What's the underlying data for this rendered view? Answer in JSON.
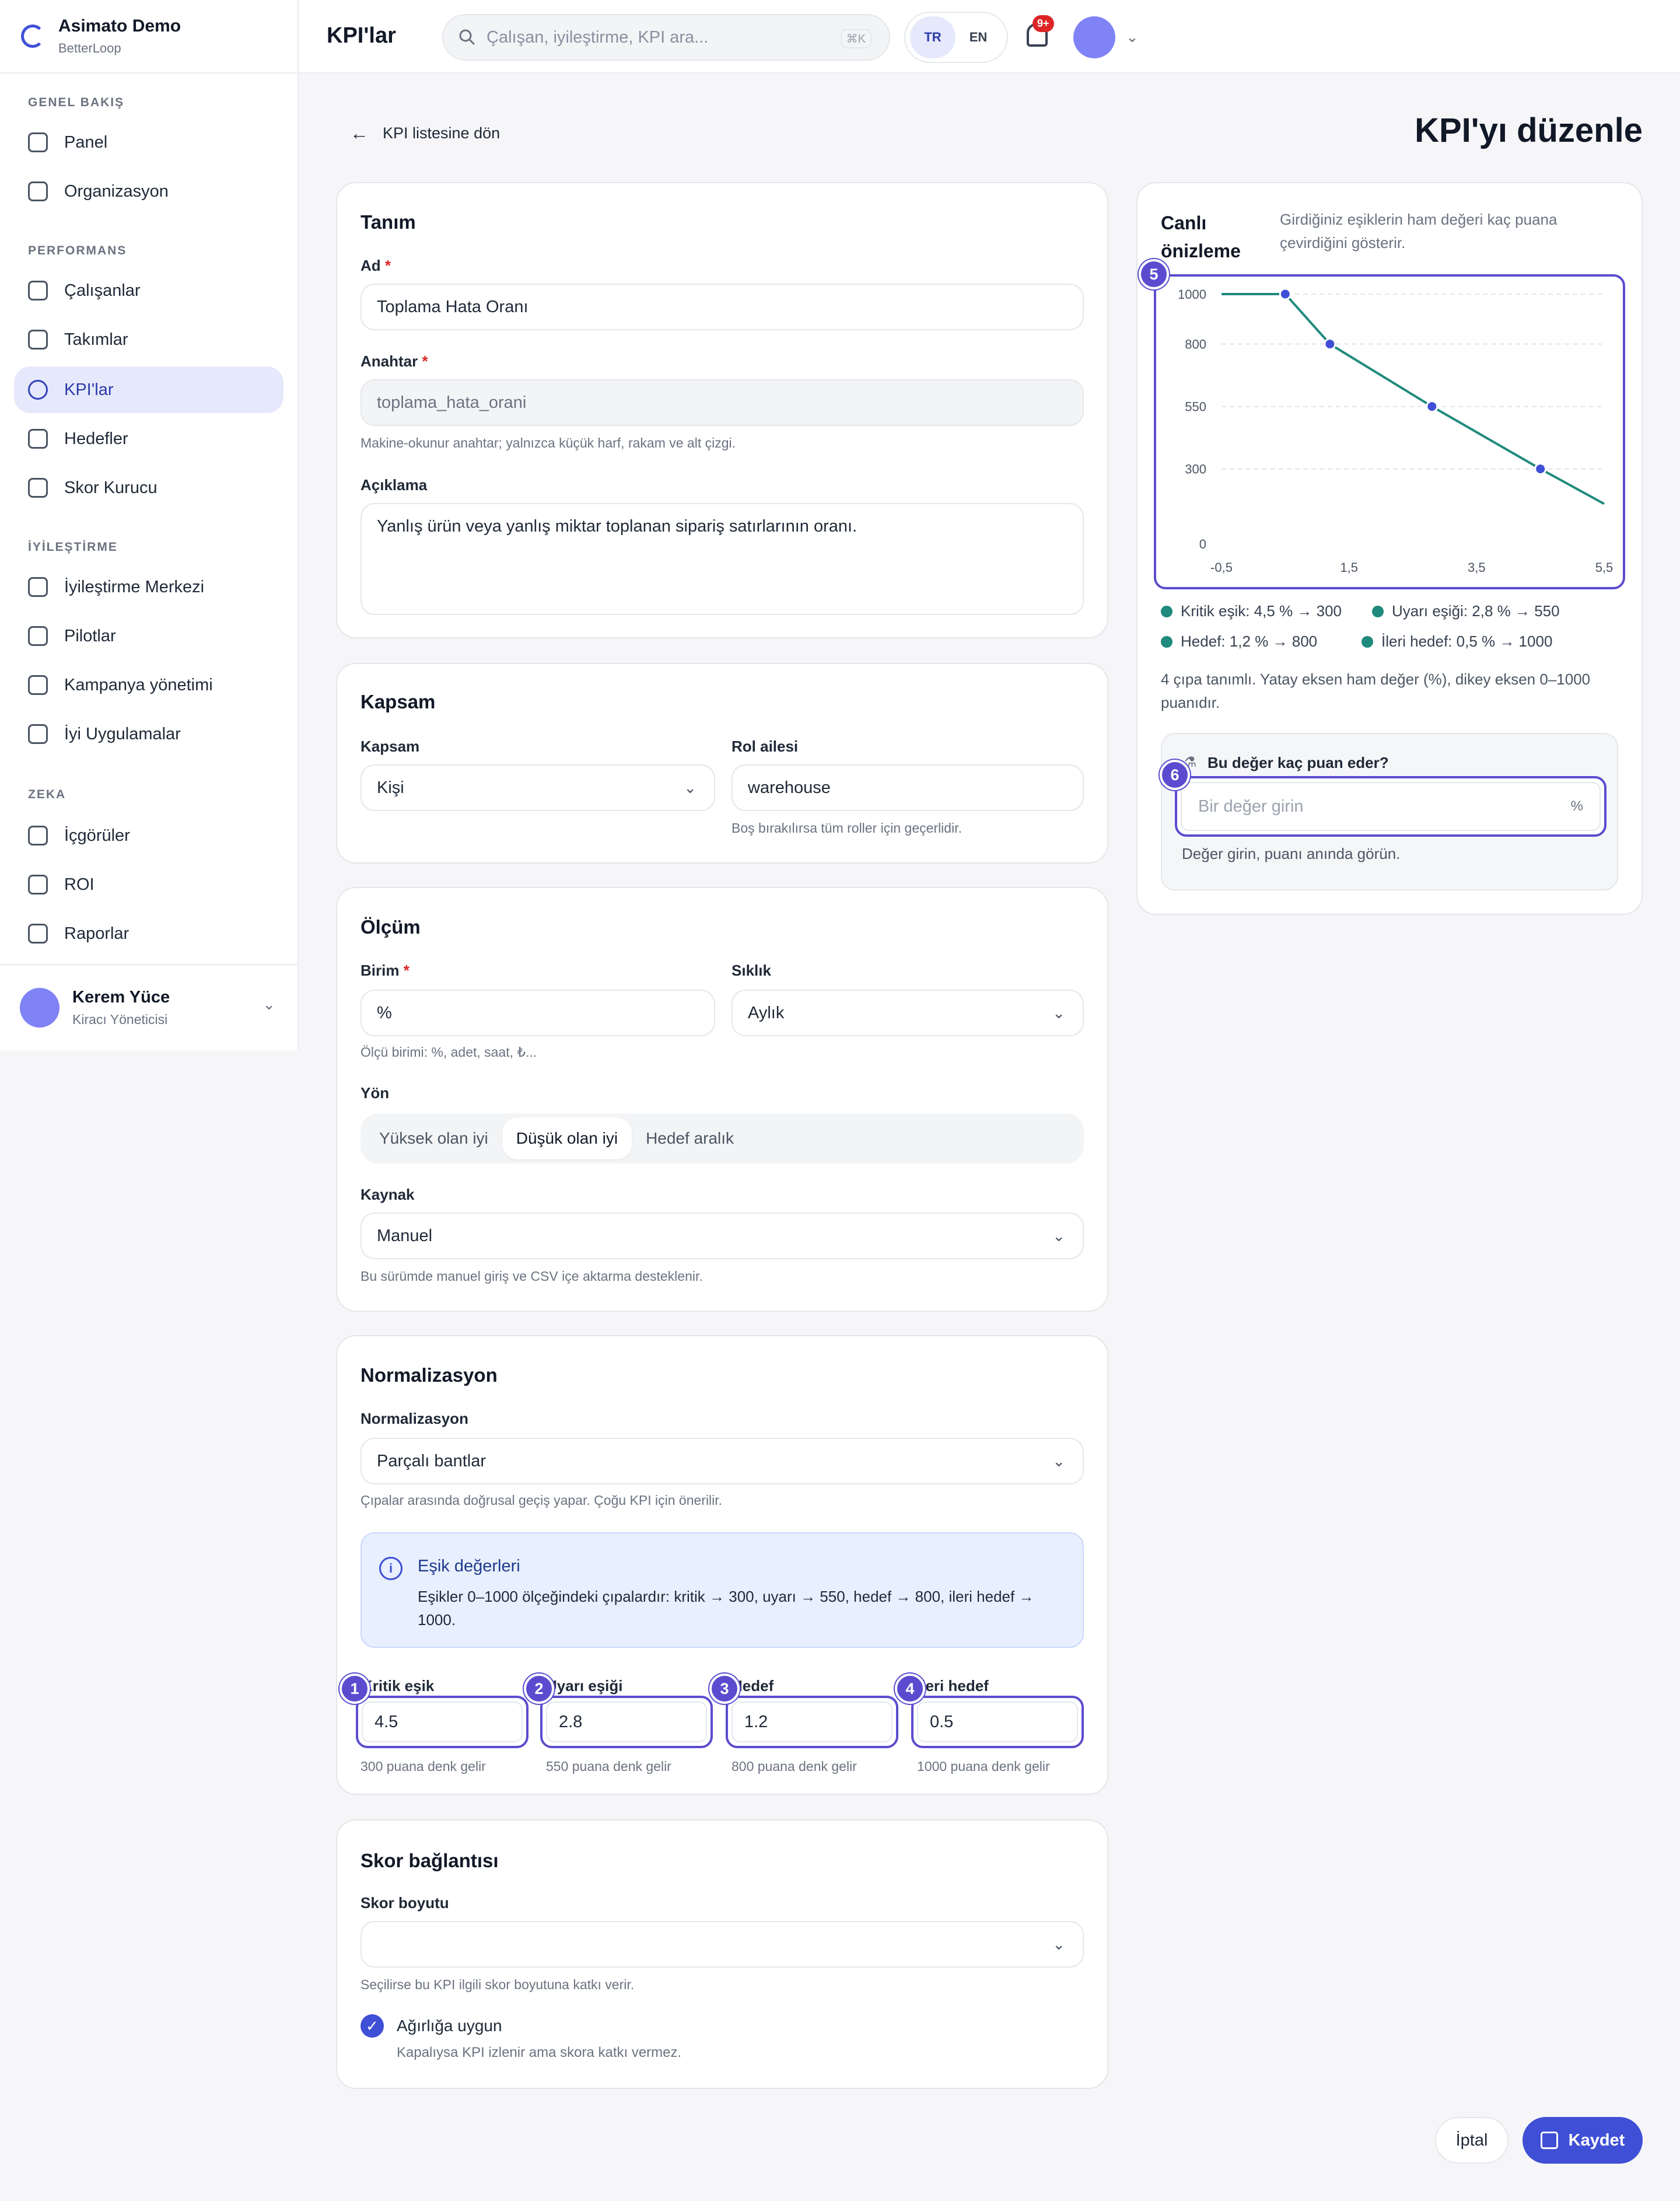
{
  "brand": {
    "name": "Asimato Demo",
    "sub": "BetterLoop"
  },
  "sidebar": {
    "sections": [
      {
        "title": "GENEL BAKIŞ",
        "items": [
          {
            "label": "Panel",
            "icon": "grid-icon"
          },
          {
            "label": "Organizasyon",
            "icon": "building-icon"
          }
        ]
      },
      {
        "title": "PERFORMANS",
        "items": [
          {
            "label": "Çalışanlar",
            "icon": "users-icon"
          },
          {
            "label": "Takımlar",
            "icon": "team-icon"
          },
          {
            "label": "KPI'lar",
            "icon": "gauge-icon",
            "active": true
          },
          {
            "label": "Hedefler",
            "icon": "target-icon"
          },
          {
            "label": "Skor Kurucu",
            "icon": "sliders-icon"
          }
        ]
      },
      {
        "title": "İYİLEŞTİRME",
        "items": [
          {
            "label": "İyileştirme Merkezi",
            "icon": "lightbulb-icon"
          },
          {
            "label": "Pilotlar",
            "icon": "flask-icon"
          },
          {
            "label": "Kampanya yönetimi",
            "icon": "clipboard-icon"
          },
          {
            "label": "İyi Uygulamalar",
            "icon": "book-icon"
          }
        ]
      },
      {
        "title": "ZEKA",
        "items": [
          {
            "label": "İçgörüler",
            "icon": "sparkles-icon"
          },
          {
            "label": "ROI",
            "icon": "dollar-icon"
          },
          {
            "label": "Raporlar",
            "icon": "report-icon"
          }
        ]
      }
    ],
    "user": {
      "name": "Kerem Yüce",
      "role": "Kiracı Yöneticisi"
    }
  },
  "topbar": {
    "title": "KPI'lar",
    "search_placeholder": "Çalışan, iyileştirme, KPI ara...",
    "shortcut": "⌘K",
    "lang_tr": "TR",
    "lang_en": "EN",
    "notif_badge": "9+"
  },
  "page": {
    "back": "KPI listesine dön",
    "heading": "KPI'yı düzenle"
  },
  "tanim": {
    "title": "Tanım",
    "ad_label": "Ad",
    "ad_value": "Toplama Hata Oranı",
    "anahtar_label": "Anahtar",
    "anahtar_value": "toplama_hata_orani",
    "anahtar_help": "Makine-okunur anahtar; yalnızca küçük harf, rakam ve alt çizgi.",
    "aciklama_label": "Açıklama",
    "aciklama_value": "Yanlış ürün veya yanlış miktar toplanan sipariş satırlarının oranı."
  },
  "kapsam": {
    "title": "Kapsam",
    "kapsam_label": "Kapsam",
    "kapsam_value": "Kişi",
    "rol_label": "Rol ailesi",
    "rol_value": "warehouse",
    "rol_help": "Boş bırakılırsa tüm roller için geçerlidir."
  },
  "olcum": {
    "title": "Ölçüm",
    "birim_label": "Birim",
    "birim_value": "%",
    "birim_help": "Ölçü birimi: %, adet, saat, ₺...",
    "siklik_label": "Sıklık",
    "siklik_value": "Aylık",
    "yon_label": "Yön",
    "yon_options": [
      "Yüksek olan iyi",
      "Düşük olan iyi",
      "Hedef aralık"
    ],
    "yon_selected": "Düşük olan iyi",
    "kaynak_label": "Kaynak",
    "kaynak_value": "Manuel",
    "kaynak_help": "Bu sürümde manuel giriş ve CSV içe aktarma desteklenir."
  },
  "normalizasyon": {
    "title": "Normalizasyon",
    "label": "Normalizasyon",
    "value": "Parçalı bantlar",
    "help": "Çıpalar arasında doğrusal geçiş yapar. Çoğu KPI için önerilir.",
    "info_title": "Eşik değerleri",
    "info_text": "Eşikler 0–1000 ölçeğindeki çıpalardır: kritik → 300, uyarı → 550, hedef → 800, ileri hedef → 1000.",
    "thresholds": [
      {
        "marker": "1",
        "label": "Kritik eşik",
        "value": "4.5",
        "help": "300 puana denk gelir"
      },
      {
        "marker": "2",
        "label": "Uyarı eşiği",
        "value": "2.8",
        "help": "550 puana denk gelir"
      },
      {
        "marker": "3",
        "label": "Hedef",
        "value": "1.2",
        "help": "800 puana denk gelir"
      },
      {
        "marker": "4",
        "label": "İleri hedef",
        "value": "0.5",
        "help": "1000 puana denk gelir"
      }
    ]
  },
  "skor": {
    "title": "Skor bağlantısı",
    "boyut_label": "Skor boyutu",
    "boyut_value": "",
    "boyut_help": "Seçilirse bu KPI ilgili skor boyutuna katkı verir.",
    "agirlik_label": "Ağırlığa uygun",
    "agirlik_help": "Kapalıysa KPI izlenir ama skora katkı vermez.",
    "agirlik_checked": true
  },
  "preview": {
    "title_line1": "Canlı",
    "title_line2": "önizleme",
    "desc": "Girdiğiniz eşiklerin ham değeri kaç puana çevirdiğini gösterir.",
    "marker": "5",
    "legend": [
      "Kritik eşik: 4,5 % → 300",
      "Uyarı eşiği: 2,8 % → 550",
      "Hedef: 1,2 % → 800",
      "İleri hedef: 0,5 % → 1000"
    ],
    "note": "4 çıpa tanımlı. Yatay eksen ham değer (%), dikey eksen 0–1000 puanıdır.",
    "calc_title": "Bu değer kaç puan eder?",
    "calc_marker": "6",
    "calc_placeholder": "Bir değer girin",
    "calc_unit": "%",
    "calc_help": "Değer girin, puanı anında görün."
  },
  "actions": {
    "cancel": "İptal",
    "save": "Kaydet"
  },
  "chart_data": {
    "type": "line",
    "x": [
      -0.6,
      0.5,
      1.2,
      2.8,
      4.5,
      5.5
    ],
    "y": [
      1000,
      1000,
      800,
      550,
      300,
      160
    ],
    "points": [
      [
        0.5,
        1000
      ],
      [
        1.2,
        800
      ],
      [
        2.8,
        550
      ],
      [
        4.5,
        300
      ]
    ],
    "xticks": [
      "-0,5",
      "1,5",
      "3,5",
      "5,5"
    ],
    "xtick_values": [
      -0.5,
      1.5,
      3.5,
      5.5
    ],
    "yticks": [
      "1000",
      "800",
      "550",
      "300",
      "0"
    ],
    "ytick_values": [
      1000,
      800,
      550,
      300,
      0
    ],
    "xlim": [
      -0.5,
      5.5
    ],
    "ylim": [
      0,
      1000
    ],
    "grid": true,
    "line_color": "#1f8a7d",
    "point_color": "#3f4fd6"
  }
}
